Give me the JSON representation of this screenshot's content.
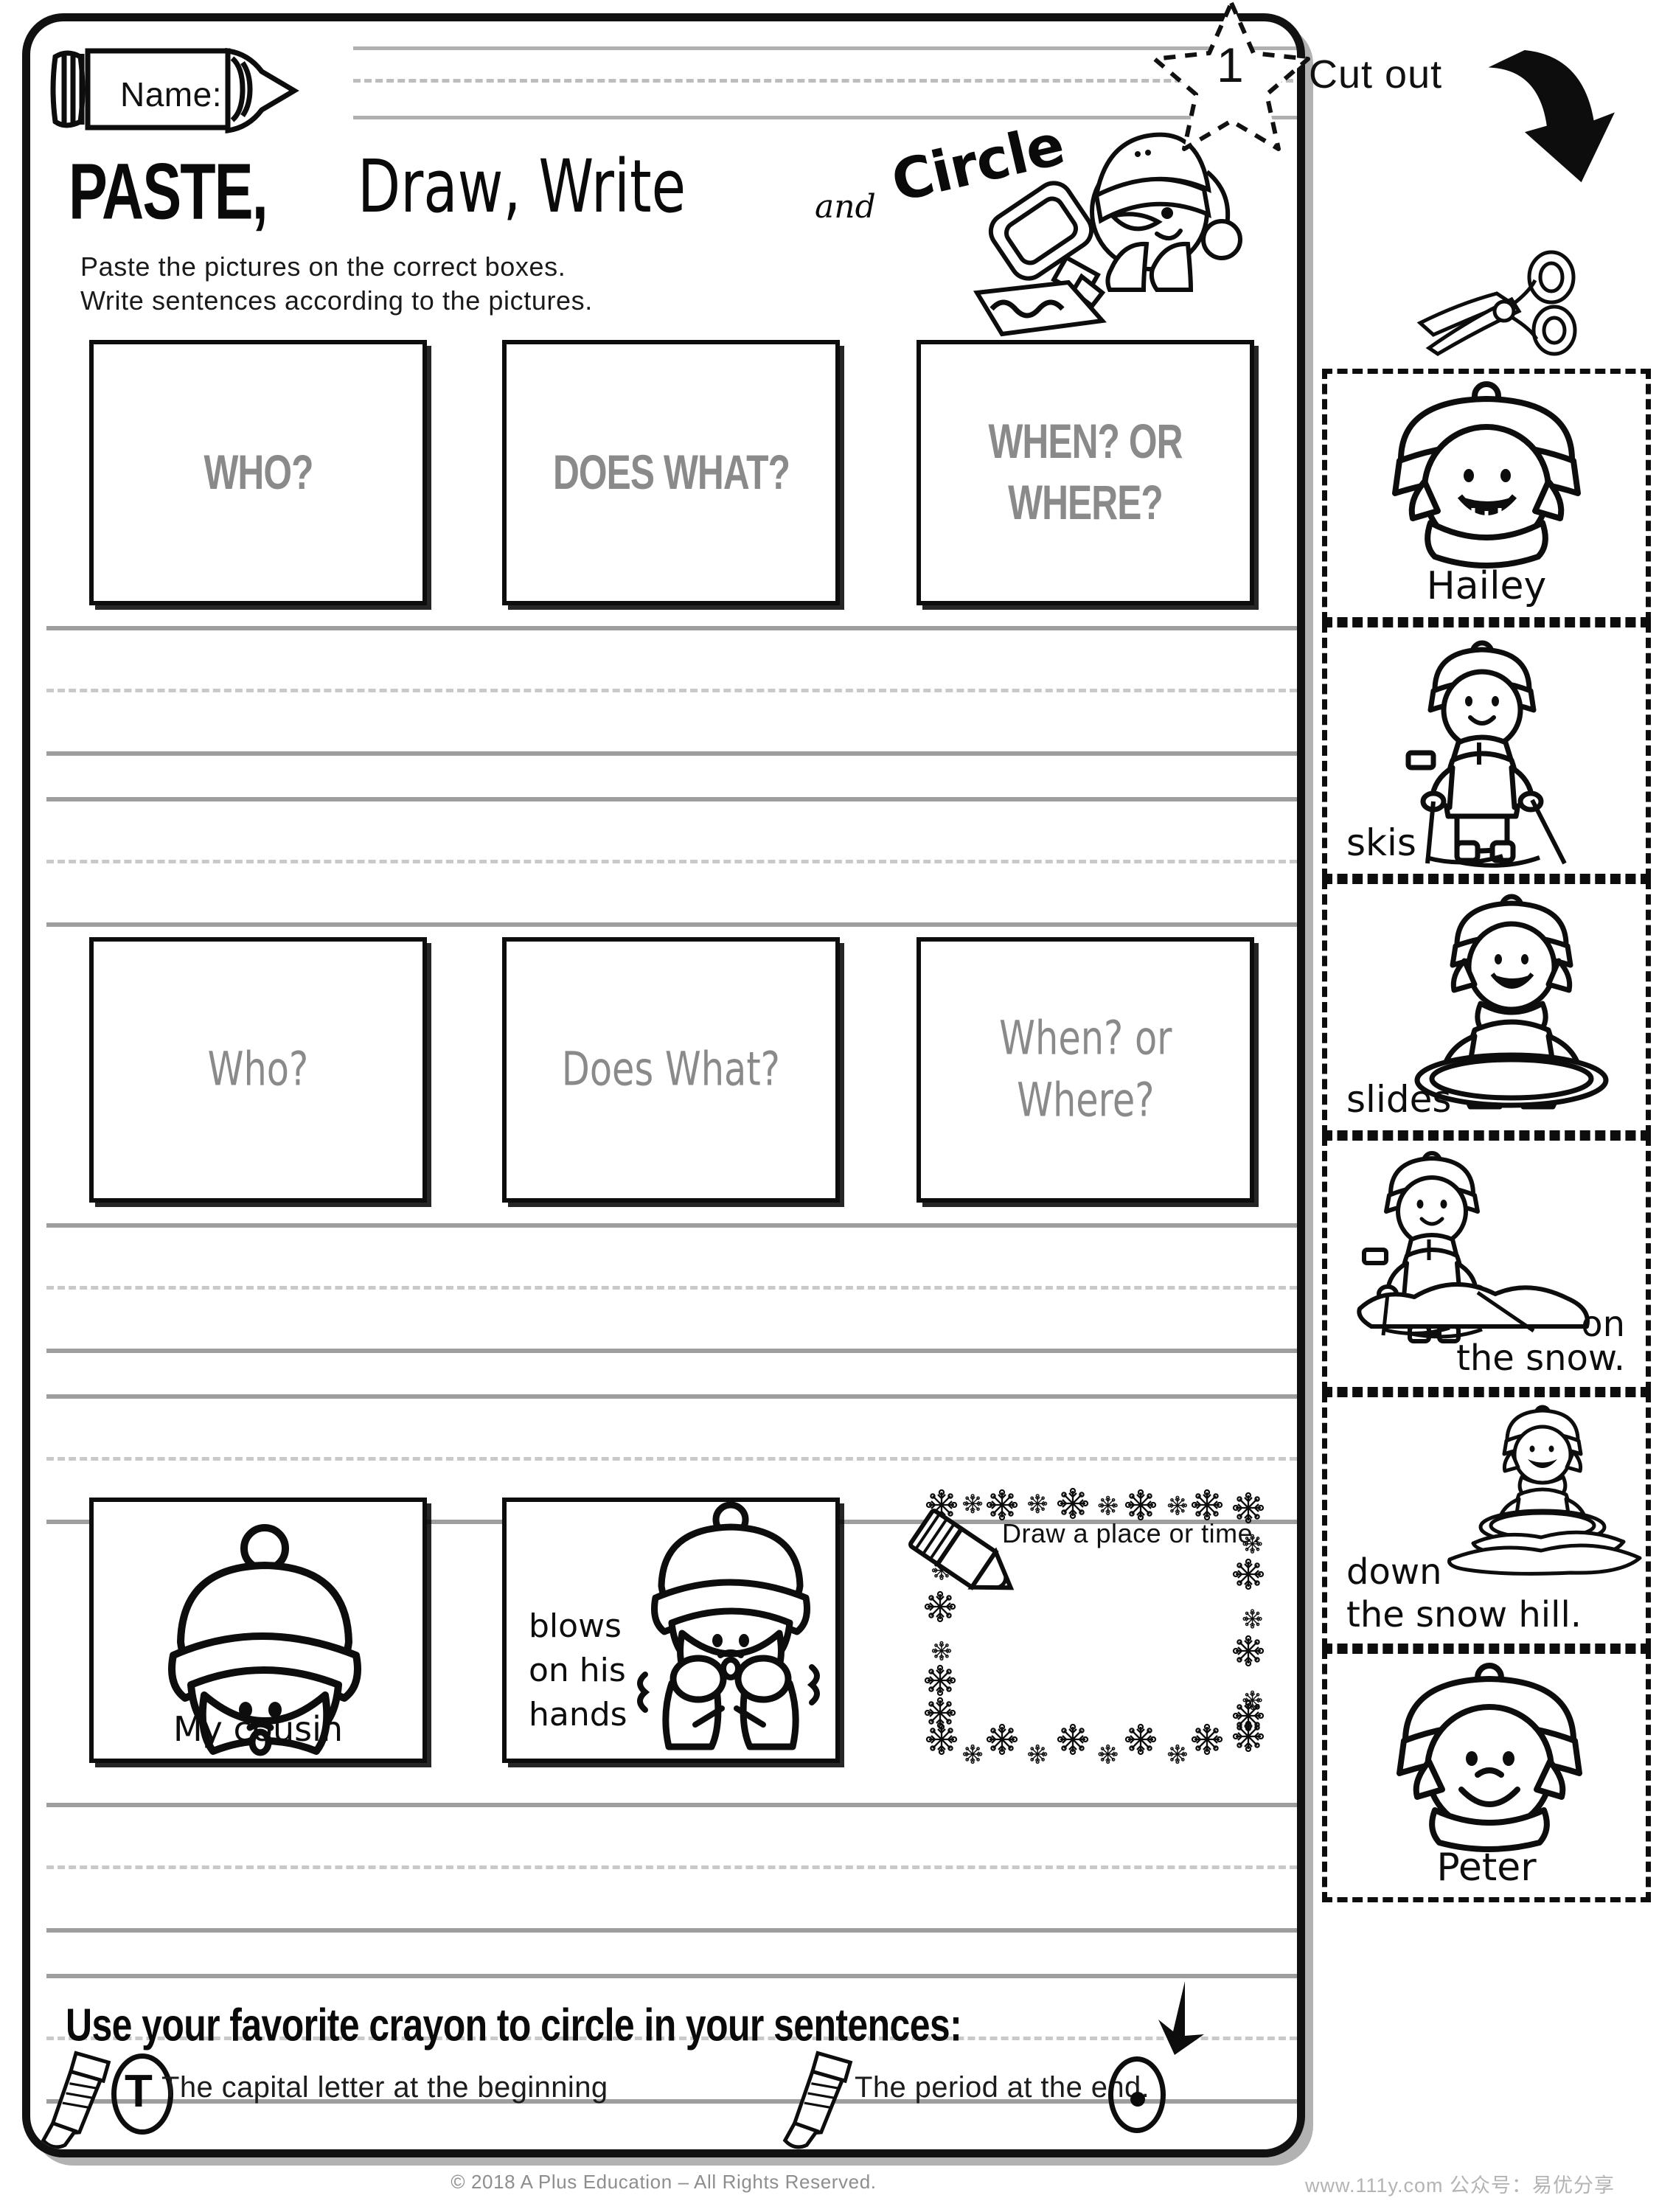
{
  "header": {
    "name_label": "Name:",
    "title_paste": "PASTE,",
    "title_draw": "Draw, Write",
    "title_and": "and",
    "title_circle": "Circle",
    "instruction_line_1": "Paste the pictures on the correct boxes.",
    "instruction_line_2": "Write sentences according to the pictures.",
    "page_number": "1"
  },
  "cutout": {
    "title": "Cut out",
    "scissors_icon": "scissors-icon",
    "arrow_icon": "curved-arrow-icon",
    "cards": [
      {
        "caption": "Hailey",
        "image": "girl-in-winter-hat-face",
        "caption_align": "center"
      },
      {
        "caption": "skis",
        "image": "boy-skiing",
        "caption_align": "left"
      },
      {
        "caption": "slides",
        "image": "girl-sledding-on-saucer",
        "caption_align": "left"
      },
      {
        "caption_line1": "on",
        "caption_line2": "the snow.",
        "image": "boy-skiing-on-snow",
        "caption_align": "right"
      },
      {
        "caption_line1": "down",
        "caption_line2": "the snow hill.",
        "image": "girl-sledding-down-hill",
        "caption_align": "left"
      },
      {
        "caption": "Peter",
        "image": "boy-in-winter-hat-face",
        "caption_align": "center"
      }
    ]
  },
  "row1": {
    "boxes": [
      {
        "label": "WHO?"
      },
      {
        "label": "DOES WHAT?"
      },
      {
        "label_line1": "WHEN? OR",
        "label_line2": "WHERE?"
      }
    ]
  },
  "row2": {
    "boxes": [
      {
        "label": "Who?"
      },
      {
        "label": "Does What?"
      },
      {
        "label_line1": "When? or",
        "label_line2": "Where?"
      }
    ]
  },
  "row3": {
    "boxes": [
      {
        "caption": "My cousin",
        "image": "boy-face-blowing"
      },
      {
        "caption_line1": "blows",
        "caption_line2": "on his",
        "caption_line3": "hands",
        "image": "boy-blowing-on-hands"
      }
    ],
    "draw_box": {
      "text": "Draw a place or time.",
      "icon": "pencil-icon",
      "border": "snowflake-border"
    }
  },
  "bottom": {
    "title": "Use your favorite crayon to circle in your sentences:",
    "item1": "The capital letter at the beginning",
    "item1_circled_letter": "T",
    "item2": "The period at the end.",
    "pencil_icon": "pencil-icon",
    "arrow_icon": "down-arrow-icon"
  },
  "footer": {
    "copyright": "© 2018 A Plus Education – All Rights Reserved.",
    "watermark": "www.111y.com   公众号：易优分享"
  },
  "colors": {
    "ink": "#0d0d0d",
    "placeholder_gray": "#8a8a8a",
    "rule_gray": "#9e9e9e",
    "dash_gray": "#c9c9c9",
    "footer_gray": "#8e8e8e"
  }
}
